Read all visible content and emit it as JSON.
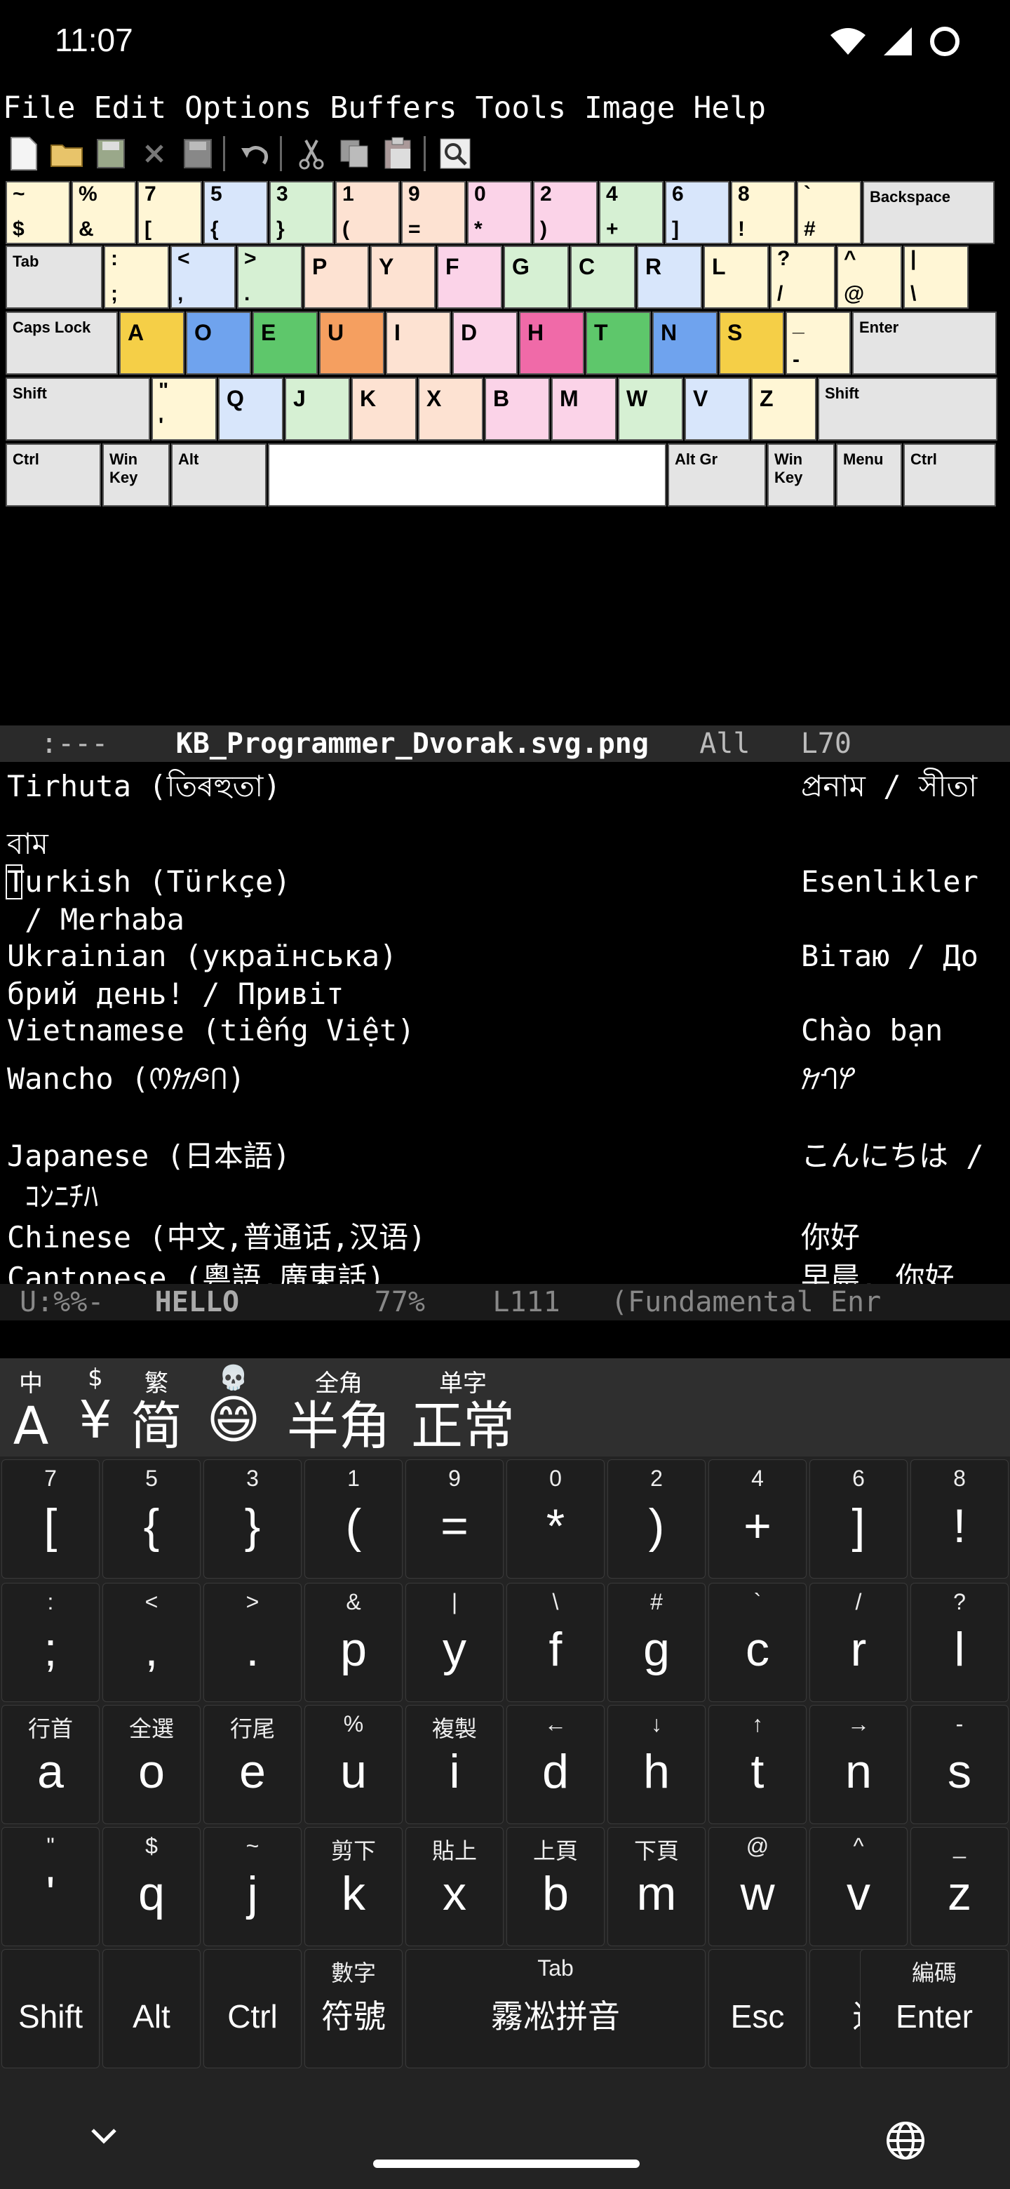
{
  "status_bar": {
    "time": "11:07"
  },
  "menu": [
    "File",
    "Edit",
    "Options",
    "Buffers",
    "Tools",
    "Image",
    "Help"
  ],
  "toolbar_icons": [
    "new-file-icon",
    "open-folder-icon",
    "save-disk-icon",
    "close-icon",
    "save-as-icon",
    "undo-icon",
    "cut-icon",
    "copy-icon",
    "paste-icon",
    "search-icon"
  ],
  "kb_image": {
    "row1": [
      {
        "t": "~",
        "b": "$",
        "c": "#fff6d5"
      },
      {
        "t": "%",
        "b": "&",
        "c": "#fff6d5"
      },
      {
        "t": "7",
        "b": "[",
        "c": "#fff6d5"
      },
      {
        "t": "5",
        "b": "{",
        "c": "#d8e6fb"
      },
      {
        "t": "3",
        "b": "}",
        "c": "#d6f0d3"
      },
      {
        "t": "1",
        "b": "(",
        "c": "#fde2d2"
      },
      {
        "t": "9",
        "b": "=",
        "c": "#fde2d2"
      },
      {
        "t": "0",
        "b": "*",
        "c": "#fbd3e8"
      },
      {
        "t": "2",
        "b": ")",
        "c": "#fbd3e8"
      },
      {
        "t": "4",
        "b": "+",
        "c": "#d6f0d3"
      },
      {
        "t": "6",
        "b": "]",
        "c": "#d8e6fb"
      },
      {
        "t": "8",
        "b": "!",
        "c": "#fff6d5"
      },
      {
        "t": "`",
        "b": "#",
        "c": "#fff6d5"
      }
    ],
    "backspace": "Backspace",
    "tab": "Tab",
    "row2": [
      {
        "t": ":",
        "b": ";",
        "c": "#fff6d5"
      },
      {
        "t": "<",
        "b": ",",
        "c": "#d8e6fb"
      },
      {
        "t": ">",
        "b": ".",
        "c": "#d6f0d3"
      },
      {
        "m": "P",
        "c": "#fde2d2"
      },
      {
        "m": "Y",
        "c": "#fde2d2"
      },
      {
        "m": "F",
        "c": "#fbd3e8"
      },
      {
        "m": "G",
        "c": "#d6f0d3"
      },
      {
        "m": "C",
        "c": "#d6f0d3"
      },
      {
        "m": "R",
        "c": "#d8e6fb"
      },
      {
        "m": "L",
        "c": "#fff6d5"
      },
      {
        "t": "?",
        "b": "/",
        "c": "#fff6d5"
      },
      {
        "t": "^",
        "b": "@",
        "c": "#fff6d5"
      },
      {
        "t": "|",
        "b": "\\",
        "c": "#fff6d5"
      }
    ],
    "capslock": "Caps Lock",
    "row3": [
      {
        "m": "A",
        "c": "#f5cf47"
      },
      {
        "m": "O",
        "c": "#6fa3ee"
      },
      {
        "m": "E",
        "c": "#5ec76b"
      },
      {
        "m": "U",
        "c": "#f59f60"
      },
      {
        "m": "I",
        "c": "#fde2d2"
      },
      {
        "m": "D",
        "c": "#fbd3e8"
      },
      {
        "m": "H",
        "c": "#f06aa8"
      },
      {
        "m": "T",
        "c": "#5ec76b"
      },
      {
        "m": "N",
        "c": "#6fa3ee"
      },
      {
        "m": "S",
        "c": "#f5cf47"
      },
      {
        "t": "_",
        "b": "-",
        "c": "#fff6d5"
      }
    ],
    "enter": "Enter",
    "shift": "Shift",
    "row4": [
      {
        "t": "\"",
        "b": "'",
        "c": "#fff6d5"
      },
      {
        "m": "Q",
        "c": "#d8e6fb"
      },
      {
        "m": "J",
        "c": "#d6f0d3"
      },
      {
        "m": "K",
        "c": "#fde2d2"
      },
      {
        "m": "X",
        "c": "#fde2d2"
      },
      {
        "m": "B",
        "c": "#fbd3e8"
      },
      {
        "m": "M",
        "c": "#fbd3e8"
      },
      {
        "m": "W",
        "c": "#d6f0d3"
      },
      {
        "m": "V",
        "c": "#d8e6fb"
      },
      {
        "m": "Z",
        "c": "#fff6d5"
      }
    ],
    "row5": {
      "ctrl": "Ctrl",
      "win": "Win Key",
      "alt": "Alt",
      "altgr": "Alt Gr",
      "menu": "Menu"
    }
  },
  "modeline1": {
    "flags": ":---",
    "buffer": "KB_Programmer_Dvorak.svg.png",
    "pos": "All",
    "line": "L70"
  },
  "buffer_lines": [
    {
      "l": "Tirhuta (তিৰহুতা)",
      "r": "প্রনাম / সীতা"
    },
    {
      "l": "বাম",
      "r": ""
    },
    {
      "l": "Turkish (Türkçe)",
      "r": "Esenlikler"
    },
    {
      "l": " / Merhaba",
      "r": ""
    },
    {
      "l": "Ukrainian (українська)",
      "r": "Вітаю / До"
    },
    {
      "l": "брий день! / Привіт",
      "r": ""
    },
    {
      "l": "Vietnamese (tiếng Việt)",
      "r": "Chào bạn"
    },
    {
      "l": "Wancho (𞋒𞋀𞋃𞋔)",
      "r": "𞋀𞋕𞋓"
    },
    {
      "l": "",
      "r": ""
    },
    {
      "l": "Japanese (日本語)",
      "r": "こんにちは /"
    },
    {
      "l": " ｺﾝﾆﾁﾊ",
      "r": ""
    },
    {
      "l": "Chinese (中文,普通话,汉语)",
      "r": "你好"
    },
    {
      "l": "Cantonese (粵語,廣東話)",
      "r": "早晨, 你好"
    }
  ],
  "modeline2": {
    "flags": "U:%%-",
    "buffer": "HELLO",
    "pct": "77%",
    "line": "L111",
    "mode": "(Fundamental Enr"
  },
  "ime": {
    "candidates": [
      {
        "h": "中",
        "v": "A"
      },
      {
        "h": "$",
        "v": "¥"
      },
      {
        "h": "繁",
        "v": "简"
      },
      {
        "h": "💀",
        "v": "😄"
      },
      {
        "h": "全角",
        "v": "半角"
      },
      {
        "h": "单字",
        "v": "正常"
      }
    ],
    "rows": [
      [
        {
          "h": "7",
          "m": "["
        },
        {
          "h": "5",
          "m": "{"
        },
        {
          "h": "3",
          "m": "}"
        },
        {
          "h": "1",
          "m": "("
        },
        {
          "h": "9",
          "m": "="
        },
        {
          "h": "0",
          "m": "*"
        },
        {
          "h": "2",
          "m": ")"
        },
        {
          "h": "4",
          "m": "+"
        },
        {
          "h": "6",
          "m": "]"
        },
        {
          "h": "8",
          "m": "!"
        }
      ],
      [
        {
          "h": ":",
          "m": ";"
        },
        {
          "h": "<",
          "m": ","
        },
        {
          "h": ">",
          "m": "."
        },
        {
          "h": "&",
          "m": "p"
        },
        {
          "h": "|",
          "m": "y"
        },
        {
          "h": "\\",
          "m": "f"
        },
        {
          "h": "#",
          "m": "g"
        },
        {
          "h": "`",
          "m": "c"
        },
        {
          "h": "/",
          "m": "r"
        },
        {
          "h": "?",
          "m": "l"
        }
      ],
      [
        {
          "h": "行首",
          "m": "a"
        },
        {
          "h": "全選",
          "m": "o"
        },
        {
          "h": "行尾",
          "m": "e"
        },
        {
          "h": "%",
          "m": "u"
        },
        {
          "h": "複製",
          "m": "i"
        },
        {
          "h": "←",
          "m": "d"
        },
        {
          "h": "↓",
          "m": "h"
        },
        {
          "h": "↑",
          "m": "t"
        },
        {
          "h": "→",
          "m": "n"
        },
        {
          "h": "-",
          "m": "s"
        }
      ],
      [
        {
          "h": "\"",
          "m": "'"
        },
        {
          "h": "$",
          "m": "q"
        },
        {
          "h": "~",
          "m": "j"
        },
        {
          "h": "剪下",
          "m": "k"
        },
        {
          "h": "貼上",
          "m": "x"
        },
        {
          "h": "上頁",
          "m": "b"
        },
        {
          "h": "下頁",
          "m": "m"
        },
        {
          "h": "@",
          "m": "w"
        },
        {
          "h": "^",
          "m": "v"
        },
        {
          "h": "_",
          "m": "z"
        }
      ]
    ],
    "bottom_row": [
      {
        "h": "",
        "m": "Shift"
      },
      {
        "h": "",
        "m": "Alt"
      },
      {
        "h": "",
        "m": "Ctrl"
      },
      {
        "h": "數字",
        "m": "符號"
      },
      {
        "h": "Tab",
        "m": "霧凇拼音"
      },
      {
        "h": "",
        "m": "Esc"
      },
      {
        "h": "",
        "m": "退格"
      },
      {
        "h": "編碼",
        "m": "Enter"
      }
    ]
  }
}
